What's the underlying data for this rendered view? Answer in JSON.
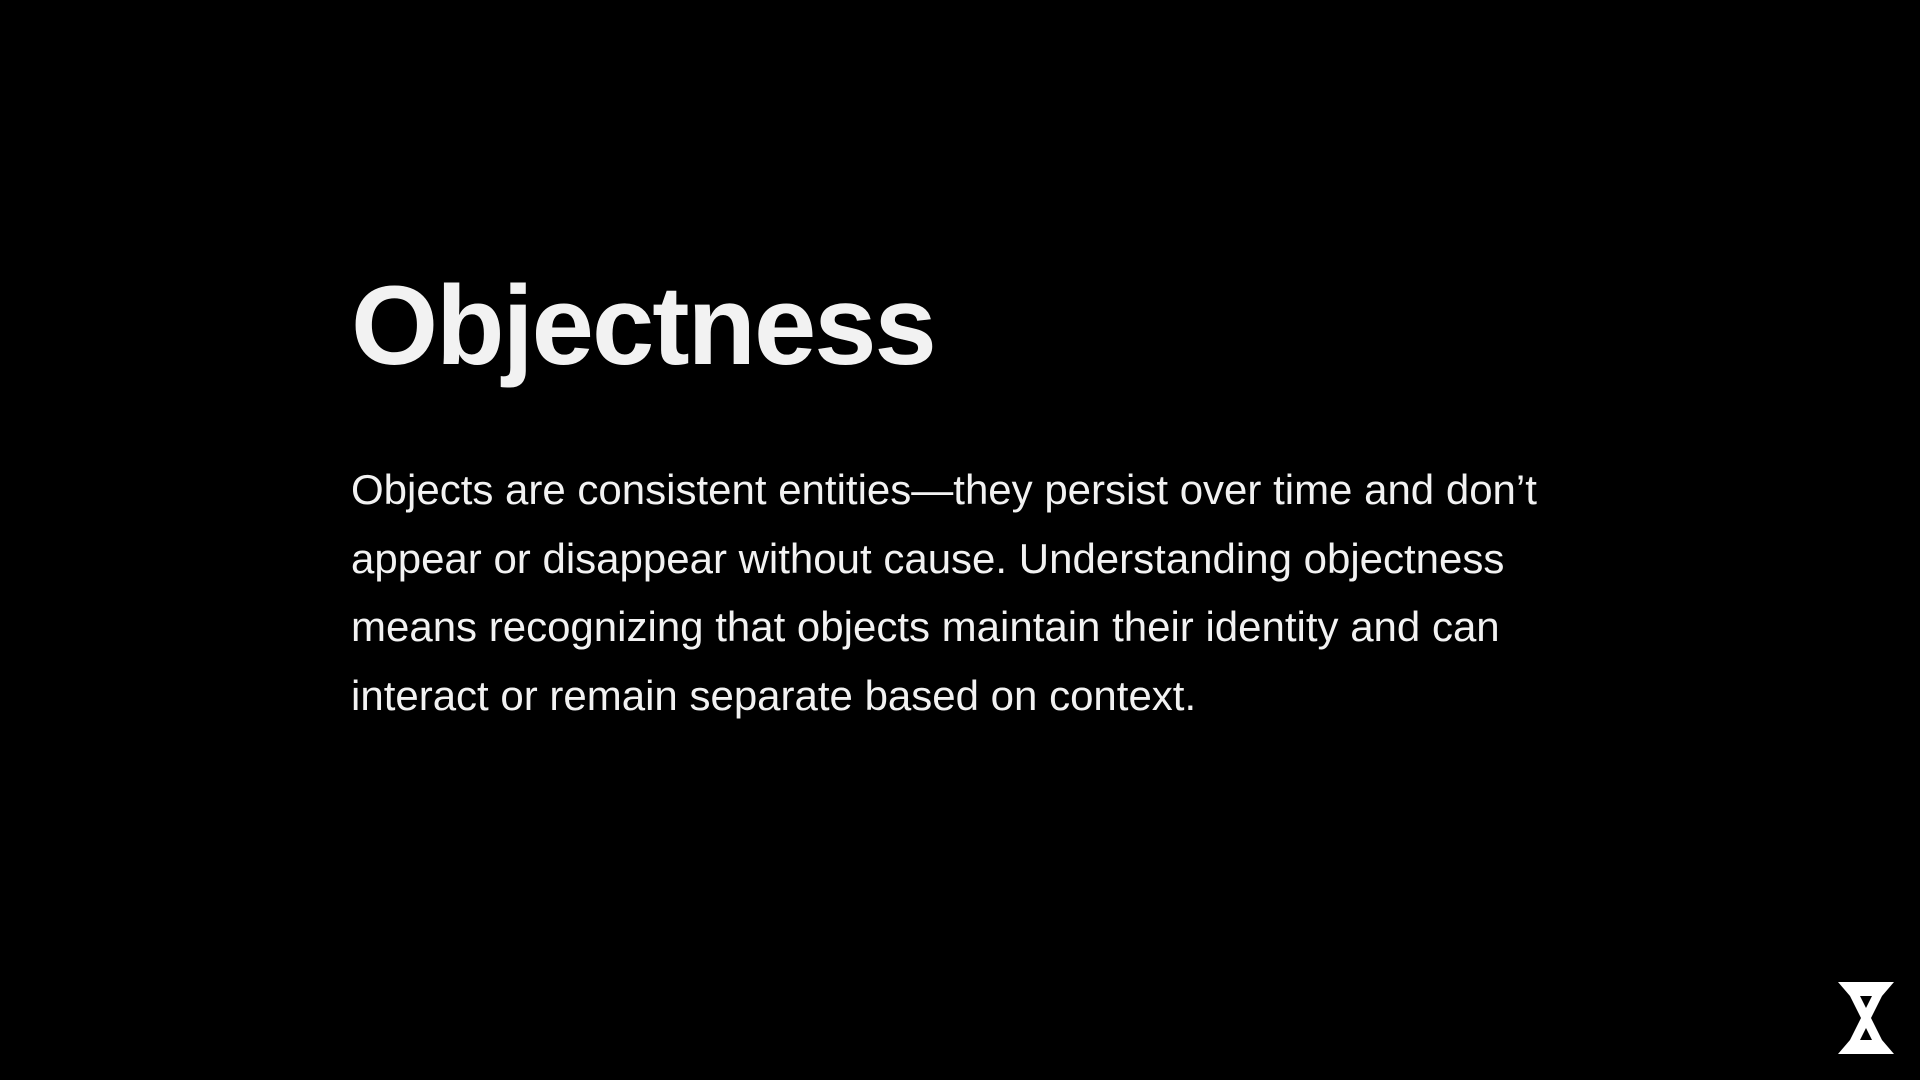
{
  "slide": {
    "title": "Objectness",
    "body": "Objects are consistent entities—they persist over time and don’t appear or disappear without cause. Understanding objectness means recognizing that objects maintain their identity and can interact or remain separate based on context."
  },
  "logo": {
    "icon": "hourglass-x-logo-icon"
  },
  "colors": {
    "background": "#000000",
    "text": "#f2f2f2"
  }
}
